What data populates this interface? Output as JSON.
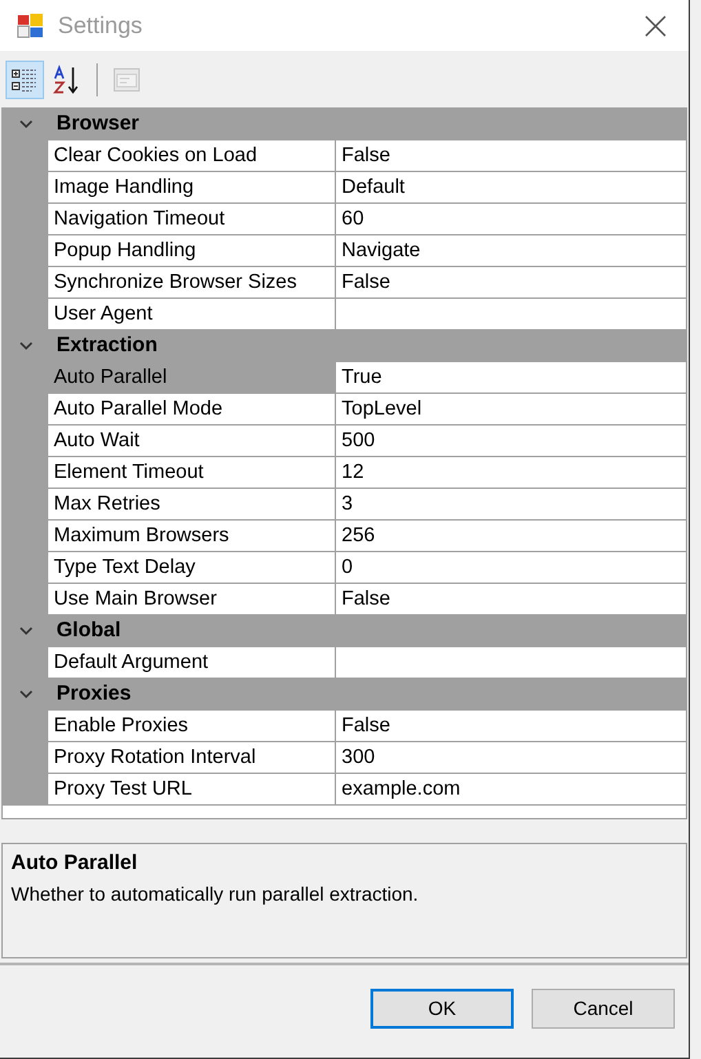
{
  "window": {
    "title": "Settings"
  },
  "toolbar": [
    {
      "kind": "categorized",
      "selected": true
    },
    {
      "kind": "alphabetical",
      "selected": false
    },
    {
      "kind": "pages",
      "selected": false,
      "disabled": true
    }
  ],
  "categories": [
    {
      "name": "Browser",
      "expanded": true,
      "properties": [
        {
          "name": "Clear Cookies on Load",
          "value": "False",
          "selected": false
        },
        {
          "name": "Image Handling",
          "value": "Default",
          "selected": false
        },
        {
          "name": "Navigation Timeout",
          "value": "60",
          "selected": false
        },
        {
          "name": "Popup Handling",
          "value": "Navigate",
          "selected": false
        },
        {
          "name": "Synchronize Browser Sizes",
          "value": "False",
          "selected": false
        },
        {
          "name": "User Agent",
          "selected": false
        }
      ]
    },
    {
      "name": "Extraction",
      "expanded": true,
      "properties": [
        {
          "name": "Auto Parallel",
          "value": "True",
          "selected": true
        },
        {
          "name": "Auto Parallel Mode",
          "value": "TopLevel",
          "selected": false
        },
        {
          "name": "Auto Wait",
          "value": "500",
          "selected": false
        },
        {
          "name": "Element Timeout",
          "value": "12",
          "selected": false
        },
        {
          "name": "Max Retries",
          "value": "3",
          "selected": false
        },
        {
          "name": "Maximum Browsers",
          "value": "256",
          "selected": false
        },
        {
          "name": "Type Text Delay",
          "value": "0",
          "selected": false
        },
        {
          "name": "Use Main Browser",
          "value": "False",
          "selected": false
        }
      ]
    },
    {
      "name": "Global",
      "expanded": true,
      "properties": [
        {
          "name": "Default Argument",
          "selected": false
        }
      ]
    },
    {
      "name": "Proxies",
      "expanded": true,
      "properties": [
        {
          "name": "Enable Proxies",
          "value": "False",
          "selected": false
        },
        {
          "name": "Proxy Rotation Interval",
          "value": "300",
          "selected": false
        },
        {
          "name": "Proxy Test URL",
          "value": "example.com",
          "selected": false
        }
      ]
    }
  ],
  "description": {
    "title": "Auto Parallel",
    "text": "Whether to automatically run parallel extraction."
  },
  "buttons": [
    {
      "label": "OK",
      "default": true
    },
    {
      "label": "Cancel",
      "default": false
    }
  ]
}
